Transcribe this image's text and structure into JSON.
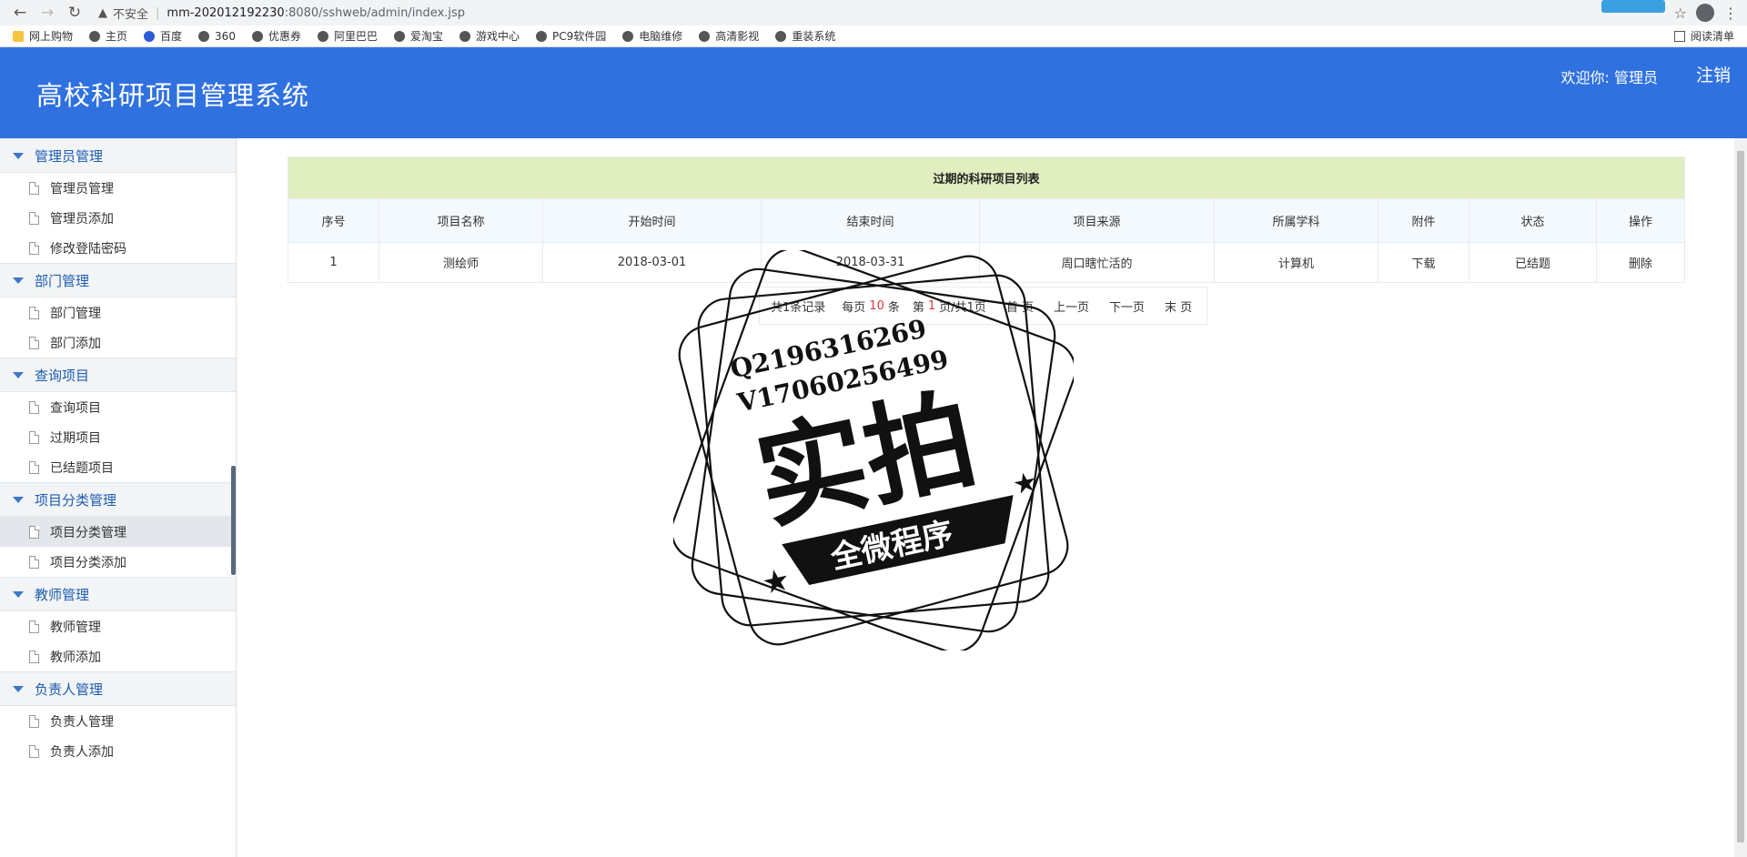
{
  "browser": {
    "insecure_label": "不安全",
    "url_host": "mm-202012192230",
    "url_rest": ":8080/sshweb/admin/index.jsp",
    "bookmarks": [
      "网上购物",
      "主页",
      "百度",
      "360",
      "优惠券",
      "阿里巴巴",
      "爱淘宝",
      "游戏中心",
      "PC9软件园",
      "电脑维修",
      "高清影视",
      "重装系统"
    ],
    "reading_list": "阅读清单"
  },
  "header": {
    "title": "高校科研项目管理系统",
    "welcome": "欢迎你: 管理员",
    "logout": "注销"
  },
  "sidebar": {
    "groups": [
      {
        "title": "管理员管理",
        "items": [
          "管理员管理",
          "管理员添加",
          "修改登陆密码"
        ]
      },
      {
        "title": "部门管理",
        "items": [
          "部门管理",
          "部门添加"
        ]
      },
      {
        "title": "查询项目",
        "items": [
          "查询项目",
          "过期项目",
          "已结题项目"
        ]
      },
      {
        "title": "项目分类管理",
        "items": [
          "项目分类管理",
          "项目分类添加"
        ]
      },
      {
        "title": "教师管理",
        "items": [
          "教师管理",
          "教师添加"
        ]
      },
      {
        "title": "负责人管理",
        "items": [
          "负责人管理",
          "负责人添加"
        ]
      }
    ]
  },
  "table": {
    "title": "过期的科研项目列表",
    "headers": [
      "序号",
      "项目名称",
      "开始时间",
      "结束时间",
      "项目来源",
      "所属学科",
      "附件",
      "状态",
      "操作"
    ],
    "rows": [
      [
        "1",
        "测绘师",
        "2018-03-01",
        "2018-03-31",
        "周口瞎忙活的",
        "计算机",
        "下载",
        "已结题",
        "删除"
      ]
    ]
  },
  "pager": {
    "total": "共1条记录",
    "per_page_prefix": "每页",
    "per_page_value": "10",
    "per_page_suffix": "条",
    "page_prefix": "第",
    "page_value": "1",
    "page_suffix": "页/共1页",
    "first": "首 页",
    "prev": "上一页",
    "next": "下一页",
    "last": "末 页"
  },
  "watermark": {
    "line1": "Q2196316269",
    "line2": "V17060256499",
    "big": "实拍",
    "banner": "全微程序"
  }
}
